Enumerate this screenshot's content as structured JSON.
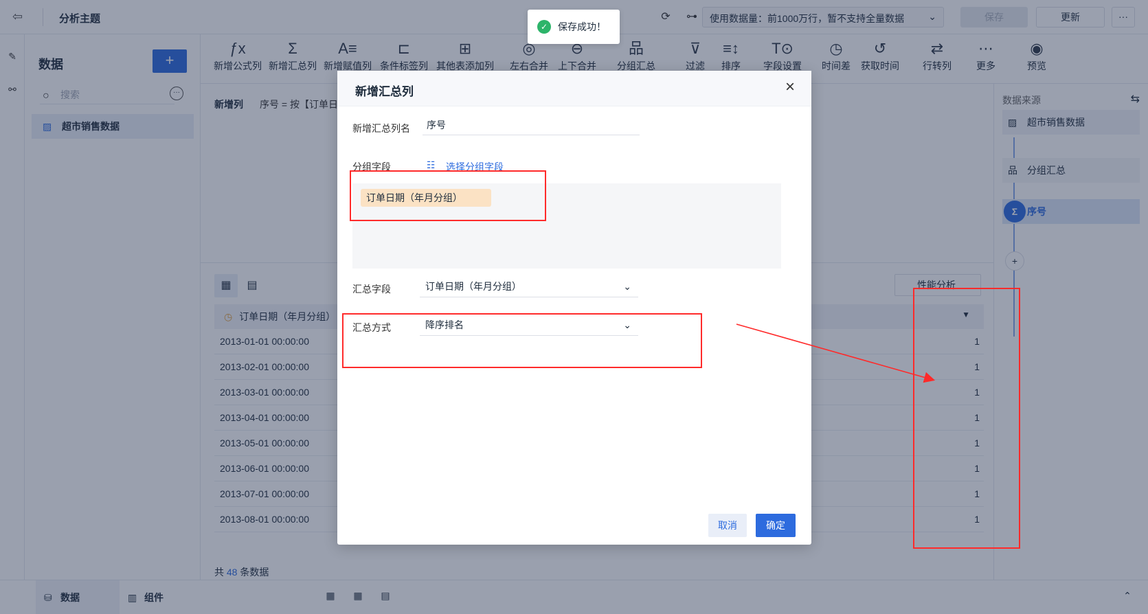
{
  "topbar": {
    "title": "分析主题",
    "data_limit": "使用数据量：前1000万行，暂不支持全量数据",
    "save": "保存",
    "update": "更新",
    "more": "···"
  },
  "left_panel": {
    "title": "数据",
    "add": "+",
    "search_placeholder": "搜索",
    "dataset": "超市销售数据"
  },
  "toolbar": {
    "items": [
      {
        "label": "新增公式列",
        "icon": "ƒx"
      },
      {
        "label": "新增汇总列",
        "icon": "Σ"
      },
      {
        "label": "新增赋值列",
        "icon": "A≡"
      },
      {
        "label": "条件标签列",
        "icon": "⊏"
      },
      {
        "label": "其他表添加列",
        "icon": "⊞"
      },
      {
        "label": "左右合并",
        "icon": "◎"
      },
      {
        "label": "上下合并",
        "icon": "⊖"
      },
      {
        "label": "分组汇总",
        "icon": "品"
      },
      {
        "label": "过滤",
        "icon": "⊽"
      },
      {
        "label": "排序",
        "icon": "≡↕"
      },
      {
        "label": "字段设置",
        "icon": "T⊙"
      },
      {
        "label": "时间差",
        "icon": "◷"
      },
      {
        "label": "获取时间",
        "icon": "↺"
      },
      {
        "label": "行转列",
        "icon": "⇄"
      },
      {
        "label": "更多",
        "icon": "⋯"
      },
      {
        "label": "预览",
        "icon": "◉"
      }
    ]
  },
  "formula": {
    "label": "新增列",
    "text": "序号 = 按【订单日"
  },
  "grid": {
    "perf_button": "性能分析",
    "header": "订单日期（年月分组）",
    "rows": [
      {
        "date": "2013-01-01 00:00:00",
        "val": "1"
      },
      {
        "date": "2013-02-01 00:00:00",
        "val": "1"
      },
      {
        "date": "2013-03-01 00:00:00",
        "val": "1"
      },
      {
        "date": "2013-04-01 00:00:00",
        "val": "1"
      },
      {
        "date": "2013-05-01 00:00:00",
        "val": "1"
      },
      {
        "date": "2013-06-01 00:00:00",
        "val": "1"
      },
      {
        "date": "2013-07-01 00:00:00",
        "val": "1"
      },
      {
        "date": "2013-08-01 00:00:00",
        "val": "1"
      }
    ],
    "count_prefix": "共 ",
    "count": "48",
    "count_suffix": " 条数据"
  },
  "right_panel": {
    "title": "数据来源",
    "nodes": {
      "source": "超市销售数据",
      "group": "分组汇总",
      "current": "序号"
    },
    "add": "+"
  },
  "bottombar": {
    "tab_data": "数据",
    "tab_component": "组件"
  },
  "toast": {
    "text": "保存成功！"
  },
  "modal": {
    "title": "新增汇总列",
    "name_label": "新增汇总列名",
    "name_value": "序号",
    "group_label": "分组字段",
    "pick_group": "选择分组字段",
    "group_chip": "订单日期（年月分组）",
    "sum_field_label": "汇总字段",
    "sum_field_value": "订单日期（年月分组）",
    "sum_method_label": "汇总方式",
    "sum_method_value": "降序排名",
    "cancel": "取消",
    "ok": "确定"
  },
  "colors": {
    "primary": "#2d6bde",
    "annotation_red": "#ff2a2a",
    "chip_bg": "#fbe2c4"
  }
}
